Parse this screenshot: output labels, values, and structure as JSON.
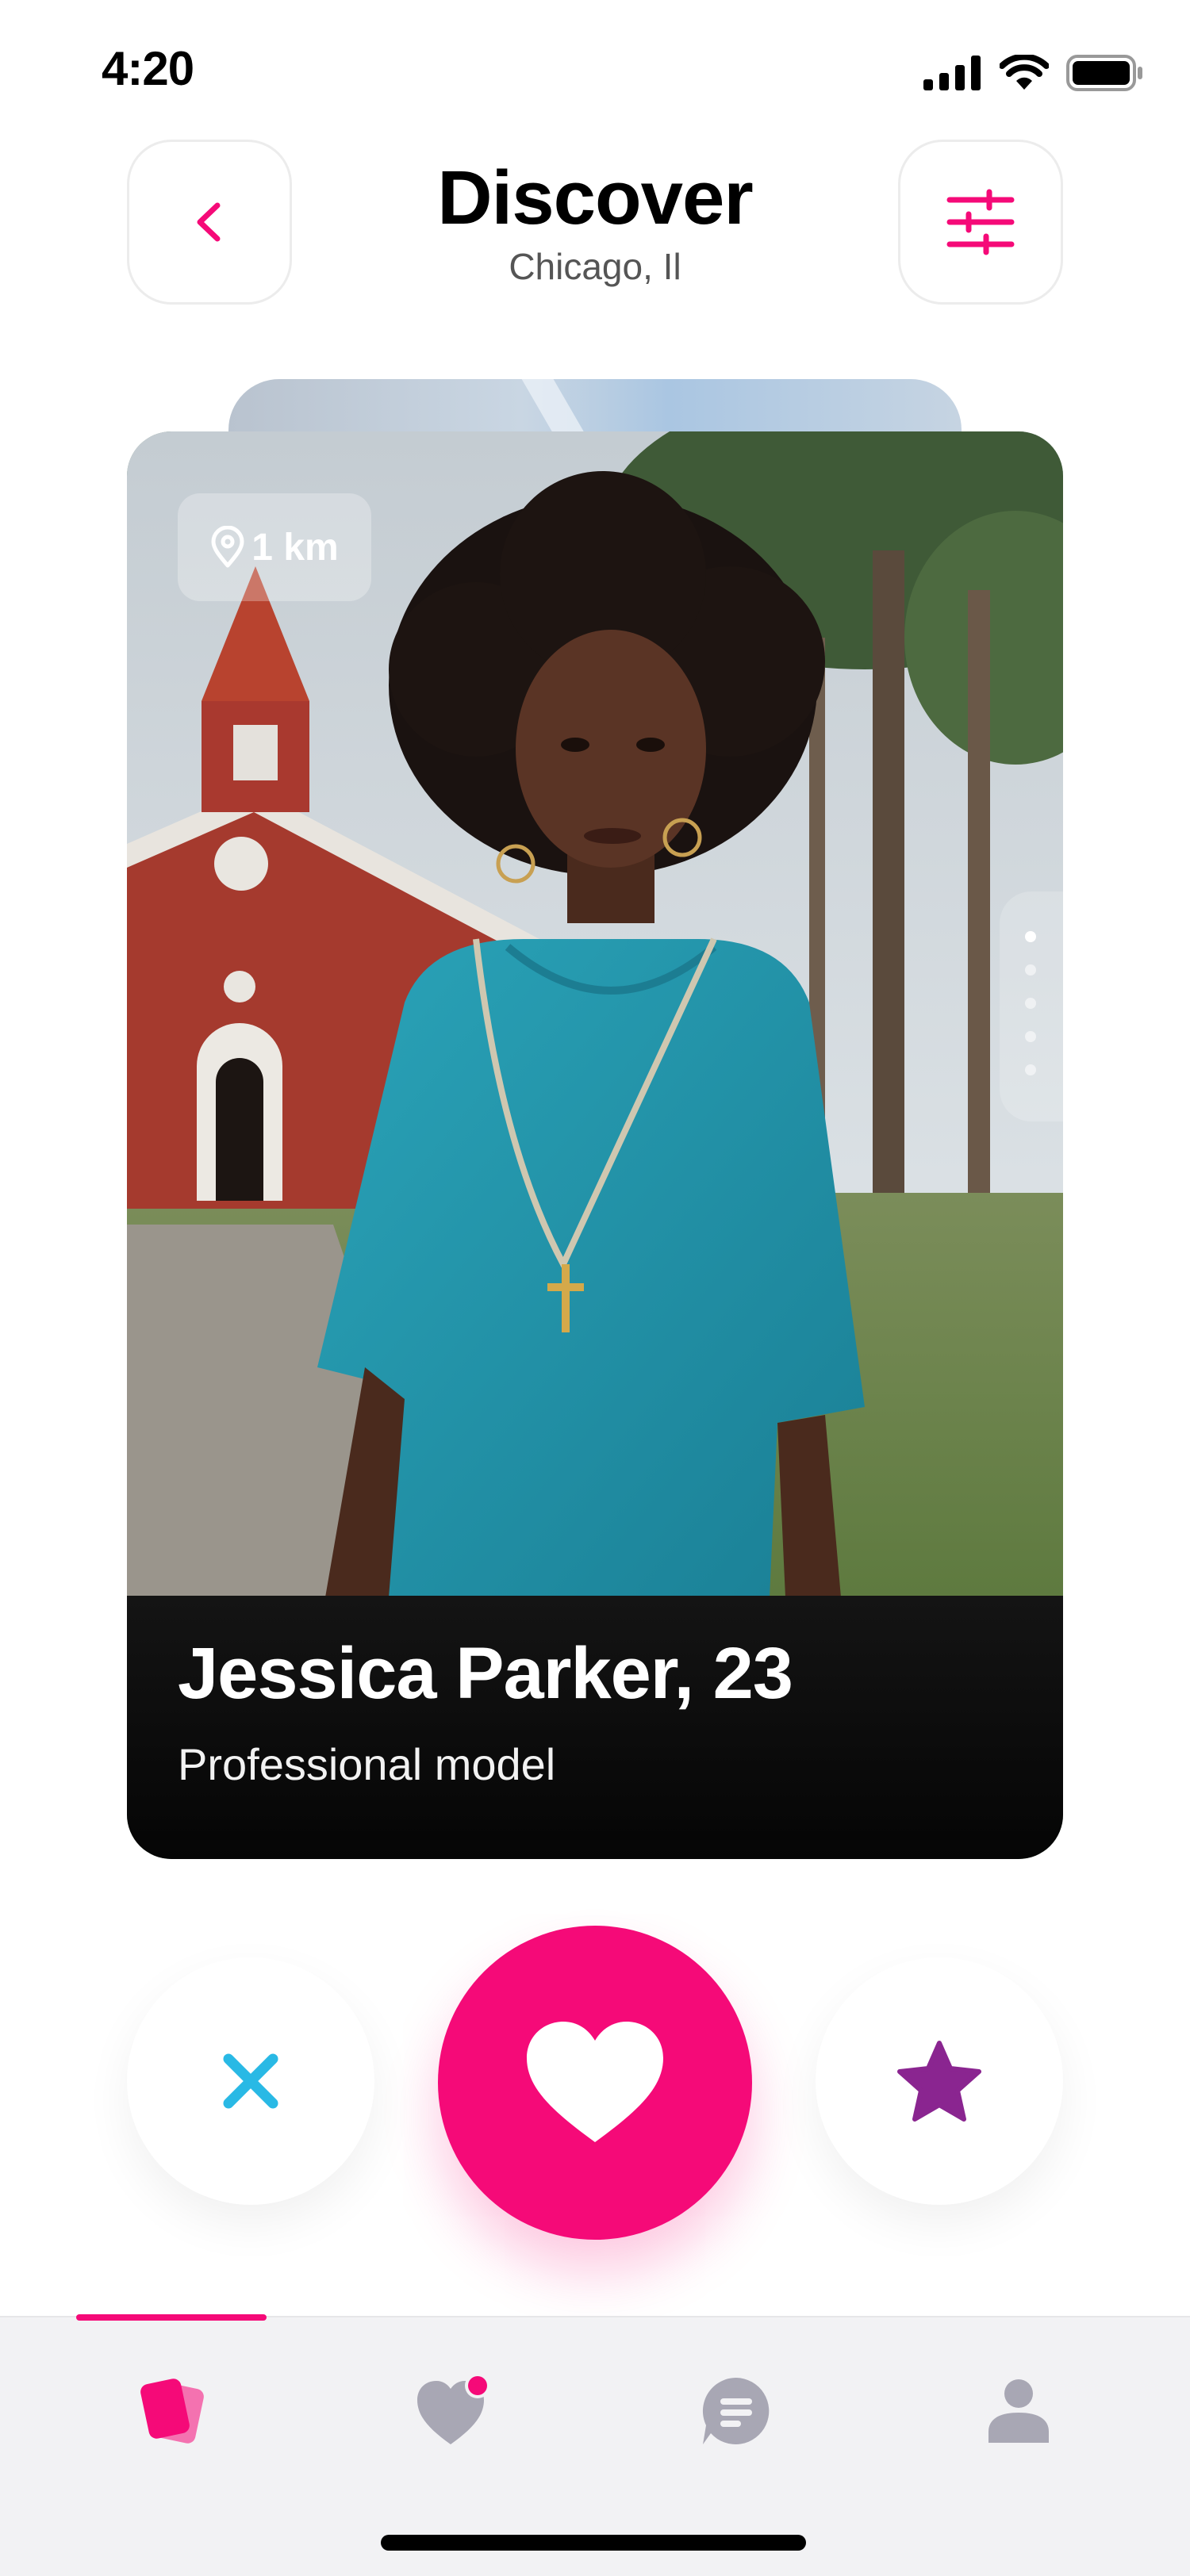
{
  "status_bar": {
    "time": "4:20",
    "icons": [
      "signal-icon",
      "wifi-icon",
      "battery-icon"
    ]
  },
  "header": {
    "title": "Discover",
    "subtitle": "Chicago, Il",
    "back_icon": "chevron-left-icon",
    "filter_icon": "sliders-icon"
  },
  "card": {
    "distance": "1 km",
    "distance_icon": "location-pin-icon",
    "name_age": "Jessica Parker, 23",
    "occupation": "Professional model",
    "photo_count": 5,
    "active_photo": 1
  },
  "actions": [
    {
      "id": "pass",
      "icon": "close-icon",
      "color": "#29b9e5"
    },
    {
      "id": "like",
      "icon": "heart-icon",
      "color": "#f50a78"
    },
    {
      "id": "super-like",
      "icon": "star-icon",
      "color": "#8a2590"
    }
  ],
  "tab_bar": {
    "active_tab": "discover",
    "tabs": [
      {
        "id": "discover",
        "icon": "cards-icon"
      },
      {
        "id": "matches",
        "icon": "heart-notification-icon",
        "has_badge": true
      },
      {
        "id": "messages",
        "icon": "chat-icon"
      },
      {
        "id": "profile",
        "icon": "user-icon"
      }
    ]
  },
  "colors": {
    "accent": "#f50a78",
    "inactive_icon": "#a8a7b4",
    "pass": "#29b9e5",
    "star": "#8a2590"
  }
}
